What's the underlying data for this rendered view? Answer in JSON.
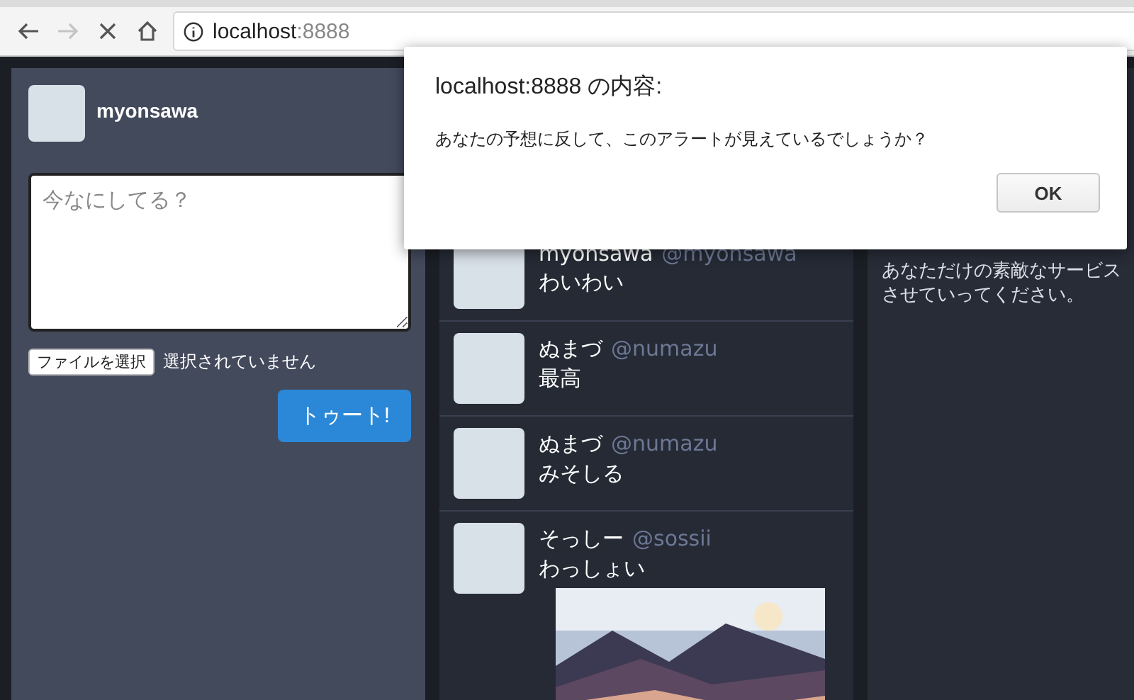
{
  "browser": {
    "nav": [
      {
        "kind": "back",
        "disabled": false
      },
      {
        "kind": "forward",
        "disabled": true
      },
      {
        "kind": "stop",
        "disabled": false
      },
      {
        "kind": "home",
        "disabled": false
      }
    ],
    "url_host": "localhost",
    "url_port": ":8888"
  },
  "profile": {
    "name": "myonsawa"
  },
  "composer": {
    "placeholder": "今なにしてる？",
    "file_button": "ファイルを選択",
    "file_status": "選択されていません",
    "submit": "トゥート!"
  },
  "timeline": [
    {
      "name": "myonsawa",
      "handle": "@myonsawa",
      "text": "わいわい"
    },
    {
      "name": "ぬまづ",
      "handle": "@numazu",
      "text": "最高"
    },
    {
      "name": "ぬまづ",
      "handle": "@numazu",
      "text": "みそしる"
    },
    {
      "name": "そっしー",
      "handle": "@sossii",
      "text": "わっしょい"
    }
  ],
  "info_panel": {
    "lines": [
      "あなただけの素敵なサービス",
      "させていってください。"
    ]
  },
  "alert": {
    "title": "localhost:8888 の内容:",
    "message": "あなたの予想に反して、このアラートが見えているでしょうか？",
    "button": "OK"
  }
}
